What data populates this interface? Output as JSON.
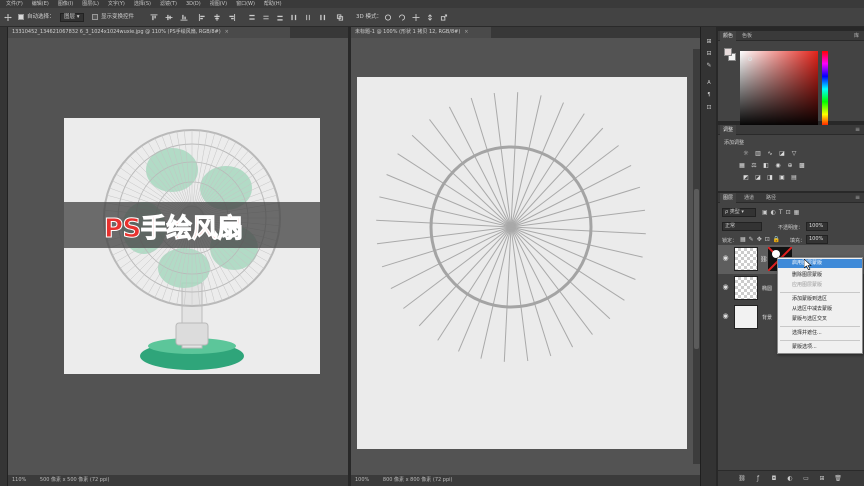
{
  "menu": [
    "文件(F)",
    "编辑(E)",
    "图像(I)",
    "图层(L)",
    "文字(Y)",
    "选择(S)",
    "滤镜(T)",
    "3D(D)",
    "视图(V)",
    "窗口(W)",
    "帮助(H)"
  ],
  "options": {
    "auto_select_label": "自动选择：",
    "auto_select_value": "图层",
    "show_transform_label": "显示变换控件",
    "mode_label": "3D 模式："
  },
  "doc1": {
    "tab_title": "13310452_134621067832 6_3_1024x1024wuxie.jpg @ 110% (PS手绘风扇, RGB/8#)",
    "close": "×",
    "banner_text": "PS手绘风扇",
    "status_zoom": "110%",
    "status_size": "500 像素 x 500 像素 (72 ppi)"
  },
  "doc2": {
    "tab_title": "未标题-1 @ 100% (形状 1 拷贝 12, RGB/8#)",
    "close": "×",
    "status_zoom": "100%",
    "status_size": "800 像素 x 800 像素 (72 ppi)"
  },
  "color_panel": {
    "tab_color": "颜色",
    "tab_swatches": "色板"
  },
  "adjust_panel": {
    "tab": "调整",
    "add_label": "添加调整"
  },
  "layers_panel": {
    "tab_layers": "图层",
    "tab_channels": "通道",
    "tab_paths": "路径",
    "kind_label": "ρ 类型",
    "blend_mode": "正常",
    "opacity_label": "不透明度：",
    "opacity_value": "100%",
    "lock_label": "锁定：",
    "fill_label": "填充：",
    "fill_value": "100%",
    "layers": [
      {
        "name": "",
        "selected": true
      },
      {
        "name": "椭圆",
        "selected": false
      },
      {
        "name": "背景",
        "selected": false
      }
    ]
  },
  "context_menu": {
    "items": [
      {
        "label": "启用图层蒙版",
        "state": "highlight"
      },
      {
        "label": "删除图层蒙版",
        "state": "normal"
      },
      {
        "label": "应用图层蒙版",
        "state": "disabled"
      },
      {
        "label": "添加蒙版到选区",
        "state": "normal"
      },
      {
        "label": "从选区中减去蒙版",
        "state": "normal"
      },
      {
        "label": "蒙版与选区交叉",
        "state": "normal"
      },
      {
        "label": "选择并遮住...",
        "state": "normal"
      },
      {
        "label": "蒙版选项...",
        "state": "normal"
      }
    ]
  },
  "right_bar": {
    "library_label": "库"
  },
  "colors": {
    "accent_red": "#e8322f",
    "highlight": "#3f8ad8",
    "fan_green": "#35a97c"
  }
}
